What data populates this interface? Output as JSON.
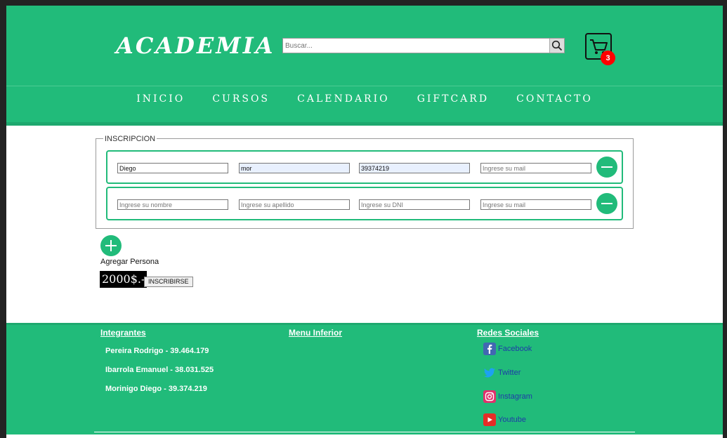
{
  "header": {
    "logo": "ACADEMIA",
    "search_placeholder": "Buscar...",
    "cart_count": "3"
  },
  "nav": [
    "INICIO",
    "CURSOS",
    "CALENDARIO",
    "GIFTCARD",
    "CONTACTO"
  ],
  "form": {
    "legend": "INSCRIPCION",
    "rows": [
      {
        "nombre": "Diego",
        "apellido": "mor",
        "dni": "39374219",
        "mail": ""
      },
      {
        "nombre": "",
        "apellido": "",
        "dni": "",
        "mail": ""
      }
    ],
    "placeholders": {
      "nombre": "Ingrese su nombre",
      "apellido": "Ingrese su apellido",
      "dni": "Ingrese su DNI",
      "mail": "Ingrese su mail"
    },
    "add_label": "Agregar Persona",
    "price": "2000$.-",
    "submit_label": "INSCRIBIRSE"
  },
  "footer": {
    "members_heading": "Integrantes",
    "members": [
      "Pereira Rodrigo - 39.464.179",
      "Ibarrola Emanuel - 38.031.525",
      "Morinigo Diego - 39.374.219"
    ],
    "menu_heading": "Menu Inferior",
    "social_heading": "Redes Sociales",
    "social": [
      {
        "label": "Facebook",
        "icon": "facebook-icon",
        "color": "#4267b2"
      },
      {
        "label": "Twitter",
        "icon": "twitter-icon",
        "color": "#1da1f2"
      },
      {
        "label": "Instagram",
        "icon": "instagram-icon",
        "color": "#e1306c"
      },
      {
        "label": "Youtube",
        "icon": "youtube-icon",
        "color": "#ff0000"
      }
    ]
  },
  "colors": {
    "brand": "#21bb7a",
    "badge": "#ff0000"
  }
}
